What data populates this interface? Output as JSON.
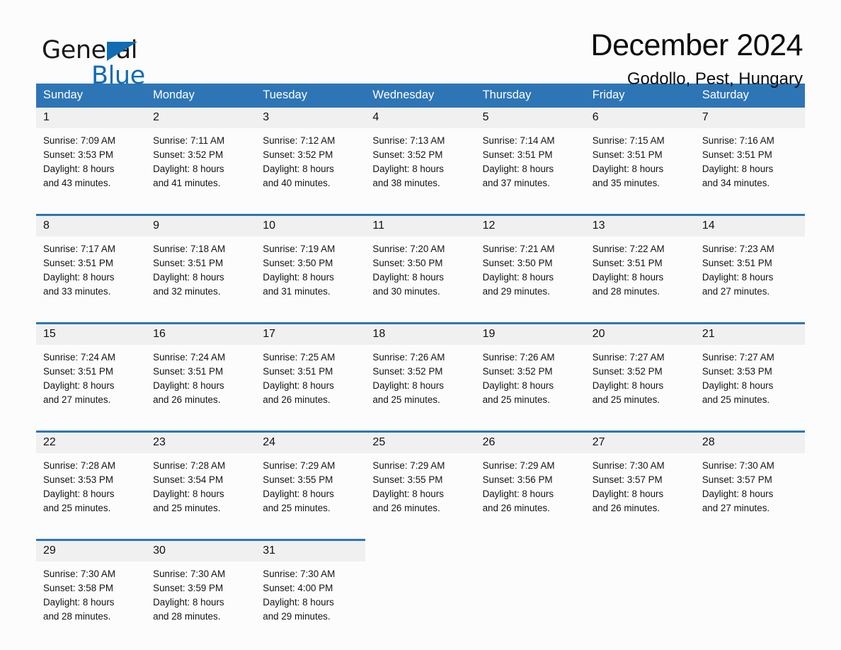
{
  "logo": {
    "word1": "General",
    "word2": "Blue",
    "triangle_icon": "triangle-icon",
    "accent_color": "#0f6cb5"
  },
  "header": {
    "title": "December 2024",
    "subtitle": "Godollo, Pest, Hungary"
  },
  "theme": {
    "header_blue": "#2e75b6",
    "daynum_gray": "#f0f0f0",
    "page_background": "#fcfcfc"
  },
  "calendar": {
    "weekday_headers": [
      "Sunday",
      "Monday",
      "Tuesday",
      "Wednesday",
      "Thursday",
      "Friday",
      "Saturday"
    ],
    "weeks": [
      [
        {
          "day": "1",
          "sunrise": "Sunrise: 7:09 AM",
          "sunset": "Sunset: 3:53 PM",
          "daylight_line1": "Daylight: 8 hours",
          "daylight_line2": "and 43 minutes."
        },
        {
          "day": "2",
          "sunrise": "Sunrise: 7:11 AM",
          "sunset": "Sunset: 3:52 PM",
          "daylight_line1": "Daylight: 8 hours",
          "daylight_line2": "and 41 minutes."
        },
        {
          "day": "3",
          "sunrise": "Sunrise: 7:12 AM",
          "sunset": "Sunset: 3:52 PM",
          "daylight_line1": "Daylight: 8 hours",
          "daylight_line2": "and 40 minutes."
        },
        {
          "day": "4",
          "sunrise": "Sunrise: 7:13 AM",
          "sunset": "Sunset: 3:52 PM",
          "daylight_line1": "Daylight: 8 hours",
          "daylight_line2": "and 38 minutes."
        },
        {
          "day": "5",
          "sunrise": "Sunrise: 7:14 AM",
          "sunset": "Sunset: 3:51 PM",
          "daylight_line1": "Daylight: 8 hours",
          "daylight_line2": "and 37 minutes."
        },
        {
          "day": "6",
          "sunrise": "Sunrise: 7:15 AM",
          "sunset": "Sunset: 3:51 PM",
          "daylight_line1": "Daylight: 8 hours",
          "daylight_line2": "and 35 minutes."
        },
        {
          "day": "7",
          "sunrise": "Sunrise: 7:16 AM",
          "sunset": "Sunset: 3:51 PM",
          "daylight_line1": "Daylight: 8 hours",
          "daylight_line2": "and 34 minutes."
        }
      ],
      [
        {
          "day": "8",
          "sunrise": "Sunrise: 7:17 AM",
          "sunset": "Sunset: 3:51 PM",
          "daylight_line1": "Daylight: 8 hours",
          "daylight_line2": "and 33 minutes."
        },
        {
          "day": "9",
          "sunrise": "Sunrise: 7:18 AM",
          "sunset": "Sunset: 3:51 PM",
          "daylight_line1": "Daylight: 8 hours",
          "daylight_line2": "and 32 minutes."
        },
        {
          "day": "10",
          "sunrise": "Sunrise: 7:19 AM",
          "sunset": "Sunset: 3:50 PM",
          "daylight_line1": "Daylight: 8 hours",
          "daylight_line2": "and 31 minutes."
        },
        {
          "day": "11",
          "sunrise": "Sunrise: 7:20 AM",
          "sunset": "Sunset: 3:50 PM",
          "daylight_line1": "Daylight: 8 hours",
          "daylight_line2": "and 30 minutes."
        },
        {
          "day": "12",
          "sunrise": "Sunrise: 7:21 AM",
          "sunset": "Sunset: 3:50 PM",
          "daylight_line1": "Daylight: 8 hours",
          "daylight_line2": "and 29 minutes."
        },
        {
          "day": "13",
          "sunrise": "Sunrise: 7:22 AM",
          "sunset": "Sunset: 3:51 PM",
          "daylight_line1": "Daylight: 8 hours",
          "daylight_line2": "and 28 minutes."
        },
        {
          "day": "14",
          "sunrise": "Sunrise: 7:23 AM",
          "sunset": "Sunset: 3:51 PM",
          "daylight_line1": "Daylight: 8 hours",
          "daylight_line2": "and 27 minutes."
        }
      ],
      [
        {
          "day": "15",
          "sunrise": "Sunrise: 7:24 AM",
          "sunset": "Sunset: 3:51 PM",
          "daylight_line1": "Daylight: 8 hours",
          "daylight_line2": "and 27 minutes."
        },
        {
          "day": "16",
          "sunrise": "Sunrise: 7:24 AM",
          "sunset": "Sunset: 3:51 PM",
          "daylight_line1": "Daylight: 8 hours",
          "daylight_line2": "and 26 minutes."
        },
        {
          "day": "17",
          "sunrise": "Sunrise: 7:25 AM",
          "sunset": "Sunset: 3:51 PM",
          "daylight_line1": "Daylight: 8 hours",
          "daylight_line2": "and 26 minutes."
        },
        {
          "day": "18",
          "sunrise": "Sunrise: 7:26 AM",
          "sunset": "Sunset: 3:52 PM",
          "daylight_line1": "Daylight: 8 hours",
          "daylight_line2": "and 25 minutes."
        },
        {
          "day": "19",
          "sunrise": "Sunrise: 7:26 AM",
          "sunset": "Sunset: 3:52 PM",
          "daylight_line1": "Daylight: 8 hours",
          "daylight_line2": "and 25 minutes."
        },
        {
          "day": "20",
          "sunrise": "Sunrise: 7:27 AM",
          "sunset": "Sunset: 3:52 PM",
          "daylight_line1": "Daylight: 8 hours",
          "daylight_line2": "and 25 minutes."
        },
        {
          "day": "21",
          "sunrise": "Sunrise: 7:27 AM",
          "sunset": "Sunset: 3:53 PM",
          "daylight_line1": "Daylight: 8 hours",
          "daylight_line2": "and 25 minutes."
        }
      ],
      [
        {
          "day": "22",
          "sunrise": "Sunrise: 7:28 AM",
          "sunset": "Sunset: 3:53 PM",
          "daylight_line1": "Daylight: 8 hours",
          "daylight_line2": "and 25 minutes."
        },
        {
          "day": "23",
          "sunrise": "Sunrise: 7:28 AM",
          "sunset": "Sunset: 3:54 PM",
          "daylight_line1": "Daylight: 8 hours",
          "daylight_line2": "and 25 minutes."
        },
        {
          "day": "24",
          "sunrise": "Sunrise: 7:29 AM",
          "sunset": "Sunset: 3:55 PM",
          "daylight_line1": "Daylight: 8 hours",
          "daylight_line2": "and 25 minutes."
        },
        {
          "day": "25",
          "sunrise": "Sunrise: 7:29 AM",
          "sunset": "Sunset: 3:55 PM",
          "daylight_line1": "Daylight: 8 hours",
          "daylight_line2": "and 26 minutes."
        },
        {
          "day": "26",
          "sunrise": "Sunrise: 7:29 AM",
          "sunset": "Sunset: 3:56 PM",
          "daylight_line1": "Daylight: 8 hours",
          "daylight_line2": "and 26 minutes."
        },
        {
          "day": "27",
          "sunrise": "Sunrise: 7:30 AM",
          "sunset": "Sunset: 3:57 PM",
          "daylight_line1": "Daylight: 8 hours",
          "daylight_line2": "and 26 minutes."
        },
        {
          "day": "28",
          "sunrise": "Sunrise: 7:30 AM",
          "sunset": "Sunset: 3:57 PM",
          "daylight_line1": "Daylight: 8 hours",
          "daylight_line2": "and 27 minutes."
        }
      ],
      [
        {
          "day": "29",
          "sunrise": "Sunrise: 7:30 AM",
          "sunset": "Sunset: 3:58 PM",
          "daylight_line1": "Daylight: 8 hours",
          "daylight_line2": "and 28 minutes."
        },
        {
          "day": "30",
          "sunrise": "Sunrise: 7:30 AM",
          "sunset": "Sunset: 3:59 PM",
          "daylight_line1": "Daylight: 8 hours",
          "daylight_line2": "and 28 minutes."
        },
        {
          "day": "31",
          "sunrise": "Sunrise: 7:30 AM",
          "sunset": "Sunset: 4:00 PM",
          "daylight_line1": "Daylight: 8 hours",
          "daylight_line2": "and 29 minutes."
        },
        {
          "day": "",
          "sunrise": "",
          "sunset": "",
          "daylight_line1": "",
          "daylight_line2": ""
        },
        {
          "day": "",
          "sunrise": "",
          "sunset": "",
          "daylight_line1": "",
          "daylight_line2": ""
        },
        {
          "day": "",
          "sunrise": "",
          "sunset": "",
          "daylight_line1": "",
          "daylight_line2": ""
        },
        {
          "day": "",
          "sunrise": "",
          "sunset": "",
          "daylight_line1": "",
          "daylight_line2": ""
        }
      ]
    ]
  }
}
